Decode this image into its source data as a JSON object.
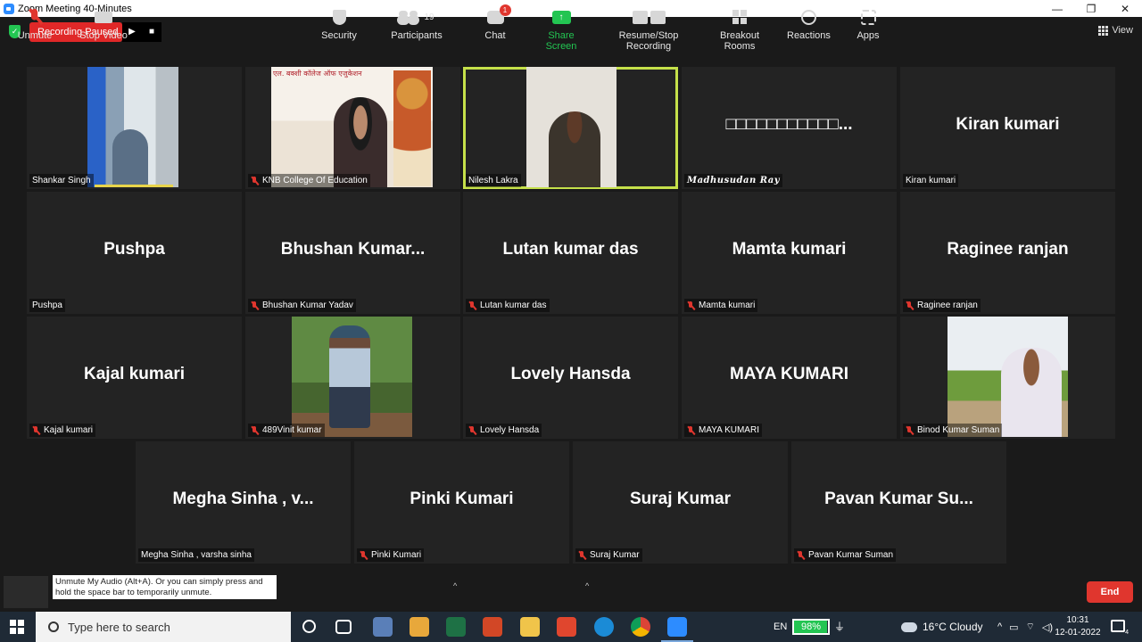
{
  "window": {
    "title": "Zoom Meeting 40-Minutes",
    "minimize": "—",
    "maximize": "❐",
    "close": "✕"
  },
  "recording": {
    "status": "Recording Paused",
    "play": "▶",
    "stop": "■"
  },
  "view": {
    "label": "View"
  },
  "participants_tiles": [
    {
      "big": "",
      "label": "Shankar Singh",
      "muted": false
    },
    {
      "big": "",
      "label": "KNB College Of Education",
      "muted": true,
      "banner": "एल. बक्शी कॉलेज ऑफ एजुकेशन"
    },
    {
      "big": "",
      "label": "Nilesh Lakra",
      "muted": false
    },
    {
      "big": "□□□□□□□□□□□...",
      "label": "Madhusudan Ray",
      "muted": false
    },
    {
      "big": "Kiran kumari",
      "label": "Kiran kumari",
      "muted": false
    },
    {
      "big": "Pushpa",
      "label": "Pushpa",
      "muted": false
    },
    {
      "big": "Bhushan  Kumar...",
      "label": "Bhushan Kumar Yadav",
      "muted": true
    },
    {
      "big": "Lutan kumar das",
      "label": "Lutan kumar das",
      "muted": true
    },
    {
      "big": "Mamta kumari",
      "label": "Mamta kumari",
      "muted": true
    },
    {
      "big": "Raginee ranjan",
      "label": "Raginee ranjan",
      "muted": true
    },
    {
      "big": "Kajal kumari",
      "label": "Kajal kumari",
      "muted": true
    },
    {
      "big": "",
      "label": "489Vinit kumar",
      "muted": true
    },
    {
      "big": "Lovely Hansda",
      "label": "Lovely Hansda",
      "muted": true
    },
    {
      "big": "MAYA KUMARI",
      "label": "MAYA KUMARI",
      "muted": true
    },
    {
      "big": "",
      "label": "Binod Kumar Suman",
      "muted": true
    },
    {
      "big": "Megha Sinha , v...",
      "label": "Megha Sinha , varsha sinha",
      "muted": false
    },
    {
      "big": "Pinki Kumari",
      "label": "Pinki Kumari",
      "muted": true
    },
    {
      "big": "Suraj Kumar",
      "label": "Suraj Kumar",
      "muted": true
    },
    {
      "big": "Pavan  Kumar Su...",
      "label": "Pavan Kumar Suman",
      "muted": true
    }
  ],
  "toolbar": {
    "unmute": "Unmute",
    "stop_video": "Stop Video",
    "tooltip": "Unmute My Audio (Alt+A). Or you can simply press and hold the space bar to temporarily unmute.",
    "security": "Security",
    "participants": "Participants",
    "participants_count": "19",
    "chat": "Chat",
    "chat_badge": "1",
    "share_screen": "Share Screen",
    "recording": "Resume/Stop Recording",
    "breakout": "Breakout Rooms",
    "reactions": "Reactions",
    "apps": "Apps",
    "end": "End",
    "caret": "^"
  },
  "taskbar": {
    "search_placeholder": "Type here to search",
    "lang": "EN",
    "battery": "98%",
    "battery_level": 0.98,
    "weather": "16°C  Cloudy",
    "time": "10:31",
    "date": "12-01-2022",
    "notifications": "4"
  },
  "colors": {
    "active_speaker": "#c5e04a",
    "recording": "#e02828",
    "end": "#e0362e",
    "share": "#23c552"
  }
}
